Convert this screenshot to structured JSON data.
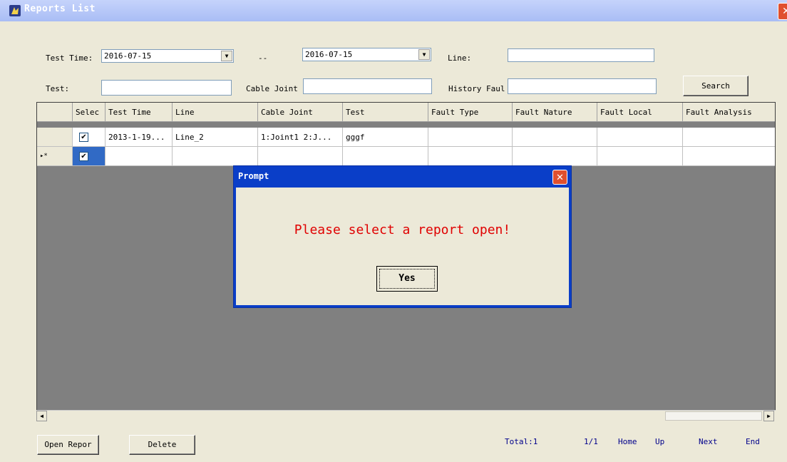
{
  "window": {
    "title": "Reports List",
    "close_glyph": "✕",
    "app_icon": "app-logo-icon"
  },
  "filters": {
    "test_time_label": "Test Time:",
    "date_from": "2016-07-15",
    "separator": "--",
    "date_to": "2016-07-15",
    "line_label": "Line:",
    "line_value": "",
    "test_label": "Test:",
    "test_value": "",
    "cable_joint_label": "Cable Joint",
    "cable_joint_value": "",
    "history_fault_label": "History Faul",
    "history_fault_value": "",
    "search_label": "Search",
    "dropdown_glyph": "▼"
  },
  "table": {
    "columns": [
      "",
      "Selec",
      "Test Time",
      "Line",
      "Cable Joint",
      "Test",
      "Fault Type",
      "Fault Nature",
      "Fault Local",
      "Fault Analysis"
    ],
    "rows": [
      {
        "marker": "",
        "selected": true,
        "test_time": "2013-1-19...",
        "line": "Line_2",
        "cable_joint": "1:Joint1 2:J...",
        "test": "gggf",
        "fault_type": "",
        "fault_nature": "",
        "fault_local": "",
        "fault_analysis": ""
      }
    ],
    "new_row_marker": "▸*",
    "new_row_selected": true,
    "check_glyph": "✔"
  },
  "scrollbar": {
    "left_glyph": "◀",
    "right_glyph": "▶"
  },
  "bottom": {
    "open_report_label": "Open Repor",
    "delete_label": "Delete",
    "total": "Total:1",
    "page": "1/1",
    "home": "Home",
    "up": "Up",
    "next": "Next",
    "end": "End"
  },
  "dialog": {
    "title": "Prompt",
    "message": "Please select a report open!",
    "yes_label": "Yes",
    "close_glyph": "✕"
  },
  "colors": {
    "title_bar": "#a9bdf5",
    "dialog_frame": "#0a3ec8",
    "message_text": "#e00000",
    "selected_cell": "#316ac5",
    "grid_background": "#808080"
  }
}
